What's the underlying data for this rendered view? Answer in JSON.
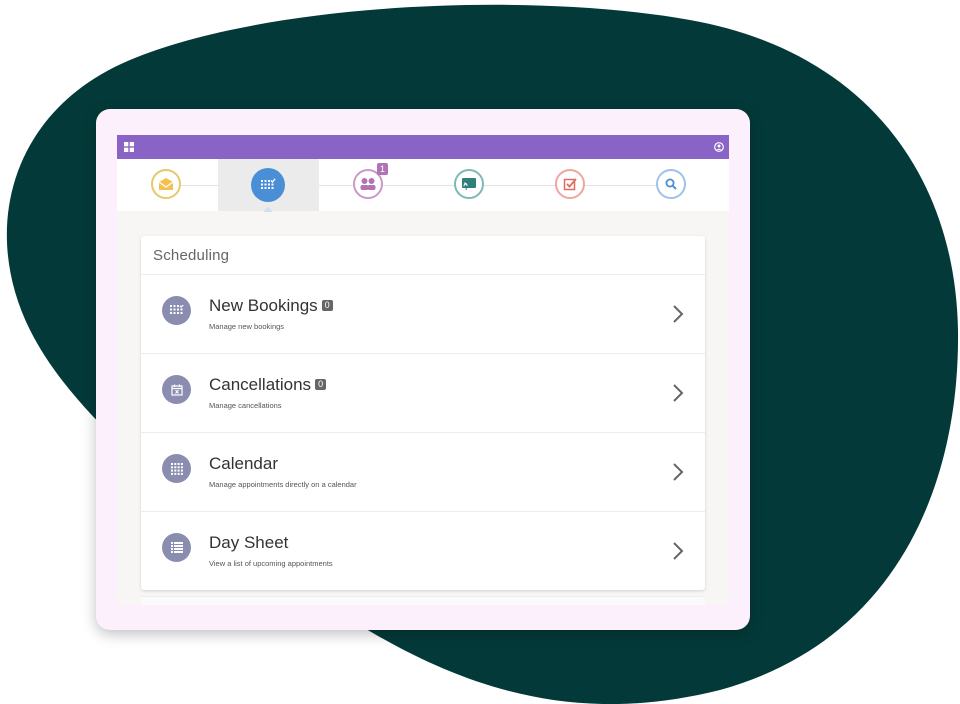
{
  "colors": {
    "blob": "#033a39",
    "topbar": "#8a63c6",
    "active_nav": "#4a8fd6",
    "item_icon_bg": "#8a8db0"
  },
  "topbar": {
    "left_icon": "grid-icon",
    "right_icon": "user-icon"
  },
  "nav": {
    "items": [
      {
        "icon": "mail-icon",
        "color": "#e9b84a",
        "active": false
      },
      {
        "icon": "calendar-check-icon",
        "color": "#4a8fd6",
        "active": true
      },
      {
        "icon": "people-icon",
        "color": "#b073b3",
        "active": false,
        "badge": "1"
      },
      {
        "icon": "cast-icon",
        "color": "#3b8f8a",
        "active": false
      },
      {
        "icon": "checkbox-icon",
        "color": "#e06a5d",
        "active": false
      },
      {
        "icon": "search-icon",
        "color": "#4a8fd6",
        "active": false
      }
    ]
  },
  "card": {
    "title": "Scheduling",
    "items": [
      {
        "title": "New Bookings",
        "count": "0",
        "subtitle": "Manage new bookings",
        "icon": "calendar-check-icon"
      },
      {
        "title": "Cancellations",
        "count": "0",
        "subtitle": "Manage cancellations",
        "icon": "calendar-x-icon"
      },
      {
        "title": "Calendar",
        "subtitle": "Manage appointments directly on a calendar",
        "icon": "calendar-grid-icon"
      },
      {
        "title": "Day Sheet",
        "subtitle": "View a list of upcoming appointments",
        "icon": "list-icon"
      }
    ]
  }
}
